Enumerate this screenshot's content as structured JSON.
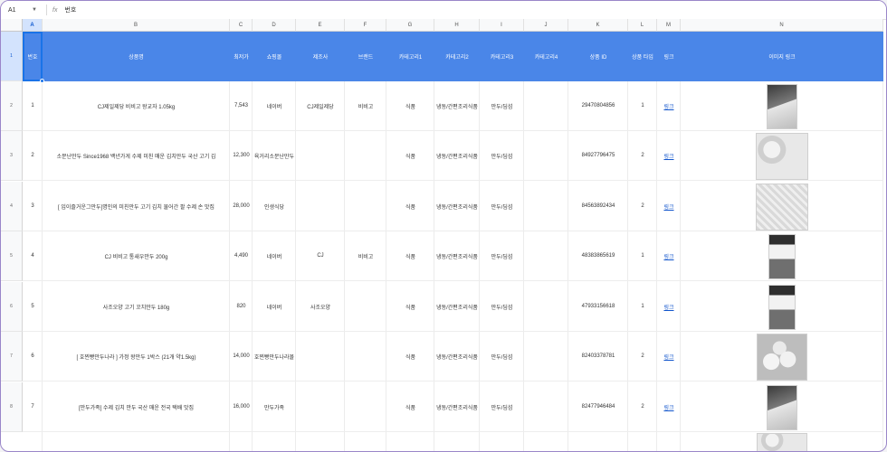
{
  "formula_bar": {
    "cell_ref": "A1",
    "fx": "fx",
    "value": "번호"
  },
  "column_letters": [
    "A",
    "B",
    "C",
    "D",
    "E",
    "F",
    "G",
    "H",
    "I",
    "J",
    "K",
    "L",
    "M",
    "N"
  ],
  "row_numbers": [
    "1",
    "2",
    "3",
    "4",
    "5",
    "6",
    "7",
    "8"
  ],
  "headers": [
    "번호",
    "상품명",
    "최저가",
    "쇼핑몰",
    "제조사",
    "브랜드",
    "카테고리1",
    "카테고리2",
    "카테고리3",
    "카테고리4",
    "상품 ID",
    "상품 타입",
    "링크",
    "이미지 링크"
  ],
  "rows": [
    {
      "no": "1",
      "name": "CJ제일제당 비비고 왕교자 1.05kg",
      "price": "7,543",
      "mall": "네이버",
      "maker": "CJ제일제당",
      "brand": "비비고",
      "cat1": "식품",
      "cat2": "냉동/간편조리식품",
      "cat3": "만두/딤섬",
      "cat4": "",
      "pid": "29470804856",
      "ptype": "1",
      "link": "링크",
      "img": "dark"
    },
    {
      "no": "2",
      "name": "소문난만두 Since1968 백년가게 수제 미친 매운 김치만두 국산 고기 김",
      "price": "12,300",
      "mall": "육거리소문난만두",
      "maker": "",
      "brand": "",
      "cat1": "식품",
      "cat2": "냉동/간편조리식품",
      "cat3": "만두/딤섬",
      "cat4": "",
      "pid": "84927796475",
      "ptype": "2",
      "link": "링크",
      "img": "food"
    },
    {
      "no": "3",
      "name": "[ 입이즐거운그만두]명인의 미친만두 고기 김치 물어간 팔 수제 손 맛집",
      "price": "28,000",
      "mall": "인생식당",
      "maker": "",
      "brand": "",
      "cat1": "식품",
      "cat2": "냉동/간편조리식품",
      "cat3": "만두/딤섬",
      "cat4": "",
      "pid": "84563892434",
      "ptype": "2",
      "link": "링크",
      "img": "plain"
    },
    {
      "no": "4",
      "name": "CJ 비비고 통새우만두 200g",
      "price": "4,490",
      "mall": "네이버",
      "maker": "CJ",
      "brand": "비비고",
      "cat1": "식품",
      "cat2": "냉동/간편조리식품",
      "cat3": "만두/딤섬",
      "cat4": "",
      "pid": "48383865619",
      "ptype": "1",
      "link": "링크",
      "img": "pack"
    },
    {
      "no": "5",
      "name": "사조오양 고기 꼬치만두 180g",
      "price": "820",
      "mall": "네이버",
      "maker": "사조오양",
      "brand": "",
      "cat1": "식품",
      "cat2": "냉동/간편조리식품",
      "cat3": "만두/딤섬",
      "cat4": "",
      "pid": "47933156618",
      "ptype": "1",
      "link": "링크",
      "img": "pack"
    },
    {
      "no": "6",
      "name": "[ 호찐빵만두나라 ] 가정 왕만두 1박스 (21개 약1.5kg)",
      "price": "14,000",
      "mall": "호찐빵만두나라몰",
      "maker": "",
      "brand": "",
      "cat1": "식품",
      "cat2": "냉동/간편조리식품",
      "cat3": "만두/딤섬",
      "cat4": "",
      "pid": "82403378781",
      "ptype": "2",
      "link": "링크",
      "img": "buns"
    },
    {
      "no": "7",
      "name": "[만두가족] 수제 김치 만두 국산 매운 전국 택배 맛집",
      "price": "16,000",
      "mall": "만두가족",
      "maker": "",
      "brand": "",
      "cat1": "식품",
      "cat2": "냉동/간편조리식품",
      "cat3": "만두/딤섬",
      "cat4": "",
      "pid": "82477946484",
      "ptype": "2",
      "link": "링크",
      "img": "dark"
    }
  ]
}
